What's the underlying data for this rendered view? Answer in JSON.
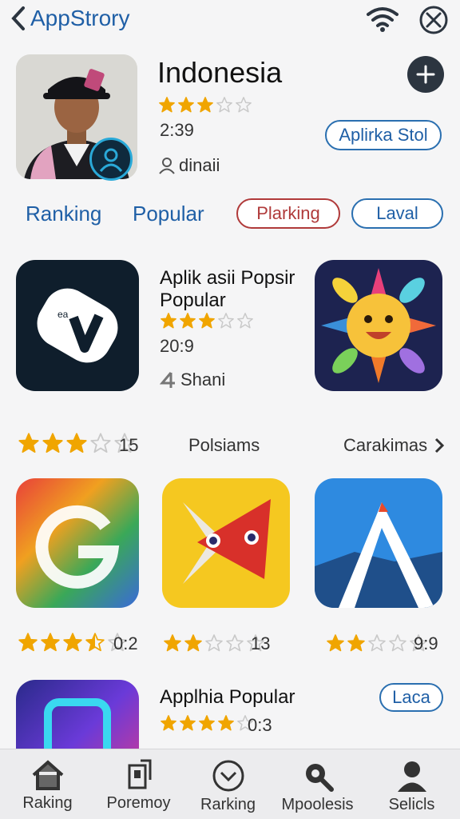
{
  "header": {
    "back_label": "AppStrory"
  },
  "profile": {
    "name": "Indonesia",
    "rating": 3,
    "time": "2:39",
    "user": "dinaii",
    "action_label": "Aplirka Stol"
  },
  "tabs": {
    "ranking": "Ranking",
    "popular": "Popular",
    "pill_1": "Plarking",
    "pill_2": "Laval"
  },
  "featured": {
    "title_line1": "Aplik asii Popsir",
    "title_line2": "Popular",
    "rating": 3,
    "time": "20:9",
    "user": "Shani"
  },
  "row_meta": {
    "rating_count": "15",
    "middle_label": "Polsiams",
    "right_label": "Carakimas"
  },
  "grid": [
    {
      "rating": 3.5,
      "value": "0:2"
    },
    {
      "rating": 2,
      "value": "13"
    },
    {
      "rating": 2,
      "value": "9:9"
    }
  ],
  "last": {
    "title": "Applhia Popular",
    "rating": 4,
    "value": "0:3",
    "action_label": "Laca"
  },
  "nav": [
    {
      "label": "Raking",
      "icon": "home-icon"
    },
    {
      "label": "Poremoy",
      "icon": "clipboard-icon"
    },
    {
      "label": "Rarking",
      "icon": "chevron-circle-icon"
    },
    {
      "label": "Mpoolesis",
      "icon": "search-icon"
    },
    {
      "label": "Selicls",
      "icon": "person-icon"
    }
  ],
  "colors": {
    "accent": "#1f5fa6",
    "star": "#f0a500",
    "star_empty": "#c9c9c9"
  }
}
